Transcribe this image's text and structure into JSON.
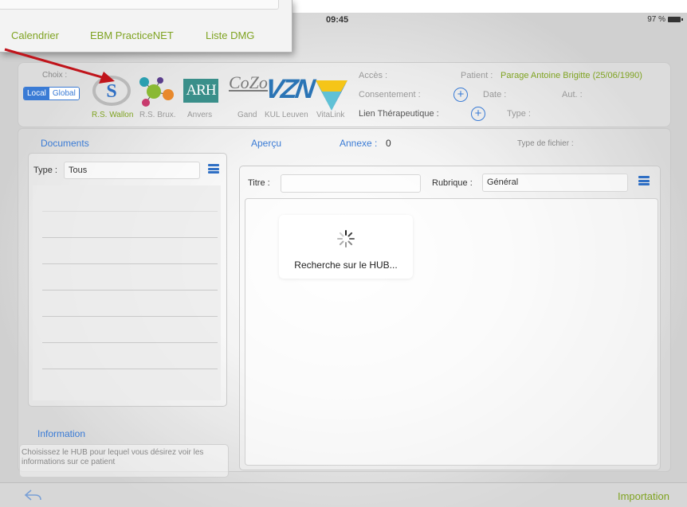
{
  "status": {
    "time": "09:45",
    "battery": "97 %"
  },
  "inset": {
    "links": [
      "Calendrier",
      "EBM PracticeNET",
      "Liste DMG"
    ]
  },
  "hub": {
    "choix_label": "Choix :",
    "segments": [
      "Local",
      "Global"
    ],
    "logo_labels": [
      "R.S. Wallon",
      "R.S. Brux.",
      "Anvers",
      "Gand",
      "KUL Leuven",
      "VitaLink"
    ],
    "logo_texts": {
      "arh": "ARH",
      "cozo": "CoZo",
      "vzn": "VZN"
    },
    "acces_label": "Accès :",
    "consentement_label": "Consentement :",
    "lien_label": "Lien Thérapeutique :",
    "patient_key": "Patient :",
    "patient_value": "Parage Antoine Brigitte (25/06/1990)",
    "date_label": "Date :",
    "aut_label": "Aut. :",
    "type_label": "Type :"
  },
  "main": {
    "documents_head": "Documents",
    "apercu_head": "Aperçu",
    "annexe_label": "Annexe :",
    "annexe_count": "0",
    "type_fichier_label": "Type de fichier :",
    "doc_type_key": "Type :",
    "doc_type_value": "Tous",
    "titre_key": "Titre :",
    "titre_value": "",
    "rubrique_key": "Rubrique :",
    "rubrique_value": "Général",
    "loading_message": "Recherche sur le HUB...",
    "information_head": "Information",
    "information_text": "Choisissez le HUB pour lequel vous désirez voir les informations sur ce patient"
  },
  "bottom": {
    "import_label": "Importation"
  },
  "colors": {
    "accent_blue": "#3a7bd5",
    "accent_green": "#7fa321",
    "arrow_red": "#c0141b"
  }
}
